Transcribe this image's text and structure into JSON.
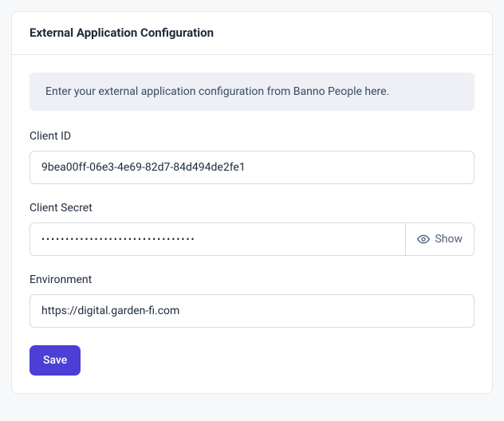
{
  "header": {
    "title": "External Application Configuration"
  },
  "banner": {
    "text": "Enter your external application configuration from Banno People here."
  },
  "fields": {
    "client_id": {
      "label": "Client ID",
      "value": "9bea00ff-06e3-4e69-82d7-84d494de2fe1"
    },
    "client_secret": {
      "label": "Client Secret",
      "masked_value": "••••••••••••••••••••••••••••••••",
      "show_label": "Show"
    },
    "environment": {
      "label": "Environment",
      "value": "https://digital.garden-fi.com"
    }
  },
  "actions": {
    "save_label": "Save"
  }
}
